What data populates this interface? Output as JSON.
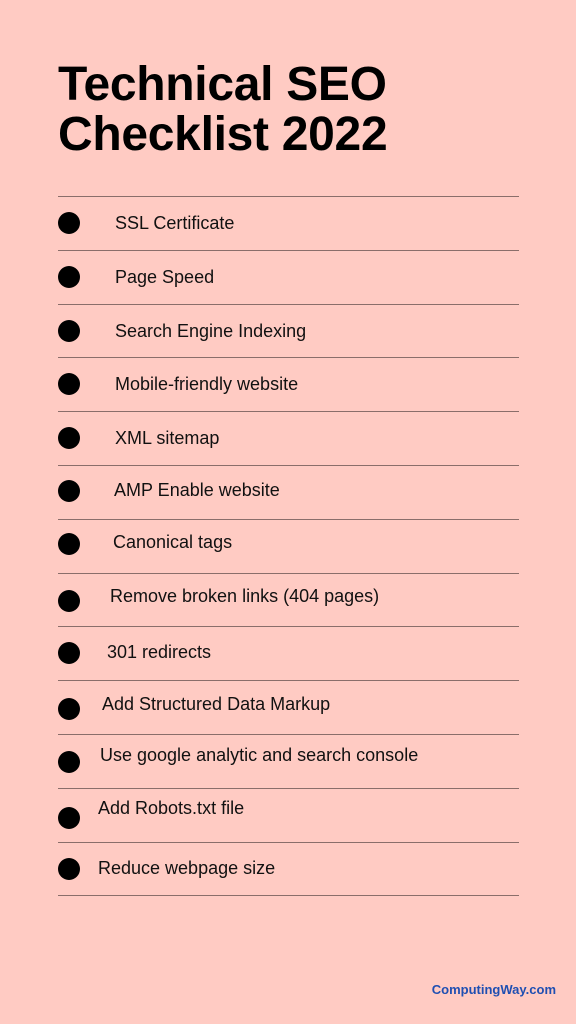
{
  "title": {
    "line1": "Technical SEO",
    "line2": "Checklist 2022"
  },
  "checklist": [
    {
      "label": "SSL Certificate"
    },
    {
      "label": "Page Speed"
    },
    {
      "label": "Search Engine Indexing"
    },
    {
      "label": "Mobile-friendly website"
    },
    {
      "label": "XML sitemap"
    },
    {
      "label": "AMP Enable website"
    },
    {
      "label": "Canonical tags"
    },
    {
      "label": "Remove broken links (404 pages)"
    },
    {
      "label": "301 redirects"
    },
    {
      "label": "Add Structured Data Markup"
    },
    {
      "label": "Use google analytic and search console"
    },
    {
      "label": "Add Robots.txt file"
    },
    {
      "label": "Reduce webpage size"
    }
  ],
  "footer": {
    "brand": "ComputingWay.com"
  },
  "colors": {
    "background": "#ffcbc3",
    "brand": "#1f4fb2",
    "bullet": "#000000"
  }
}
